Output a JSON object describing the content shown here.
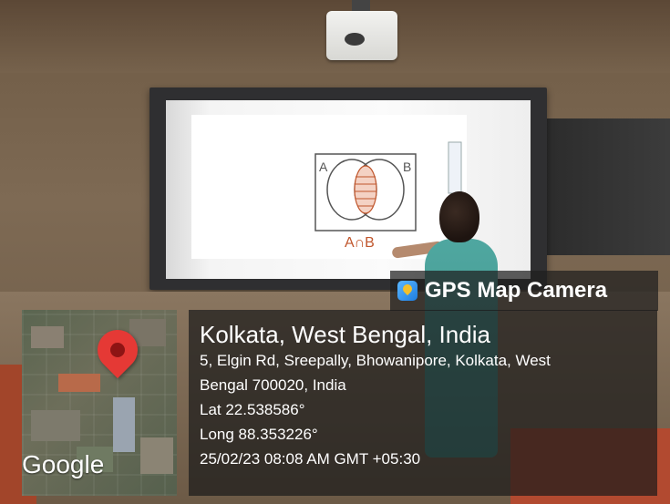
{
  "overlay": {
    "app_label": "GPS Map Camera",
    "icon": "gps-map-camera-app-icon"
  },
  "map": {
    "brand": "Google",
    "marker_icon": "map-pin-icon",
    "marker_color": "#e53935"
  },
  "location": {
    "title": "Kolkata, West Bengal, India",
    "address_line1": "5, Elgin Rd, Sreepally, Bhowanipore, Kolkata, West",
    "address_line2": "Bengal 700020, India",
    "lat": "Lat 22.538586°",
    "long": "Long 88.353226°",
    "timestamp": "25/02/23 08:08 AM GMT +05:30"
  },
  "whiteboard": {
    "label_a": "A",
    "label_b": "B",
    "caption": "A∩B"
  }
}
